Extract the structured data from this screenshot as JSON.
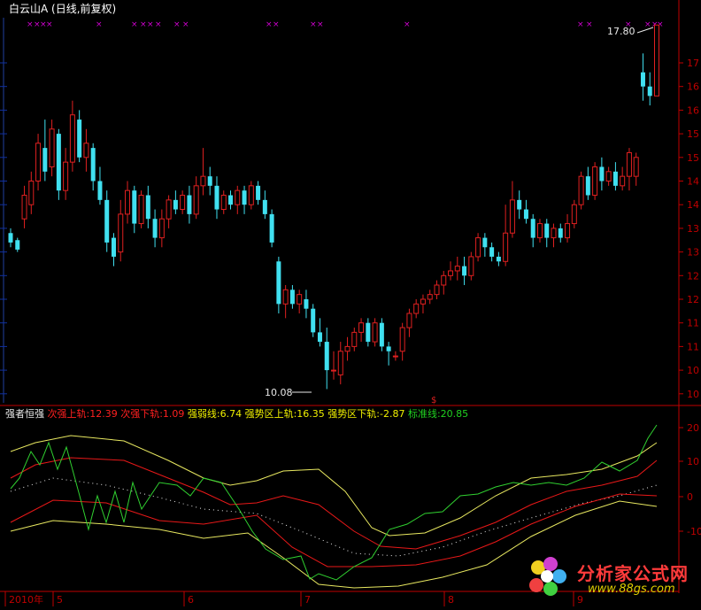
{
  "title": "白云山A (日线,前复权)",
  "price_panel": {
    "y_ticks": [
      "17",
      "16",
      "16",
      "15",
      "15",
      "14",
      "14",
      "13",
      "13",
      "12",
      "12",
      "11",
      "11",
      "10",
      "10"
    ],
    "annotations": {
      "high": "17.80",
      "low": "10.08"
    },
    "marker_top_symbol": "×",
    "marker_bottom_symbol": "$"
  },
  "indicator_panel": {
    "name": "强者恒强",
    "labels": [
      {
        "text": "次强上轨:12.39",
        "color": "#ff2020"
      },
      {
        "text": "次强下轨:1.09",
        "color": "#ff2020"
      },
      {
        "text": "强弱线:6.74",
        "color": "#f0f000"
      },
      {
        "text": "强势区上轨:16.35",
        "color": "#f0f000"
      },
      {
        "text": "强势区下轨:-2.87",
        "color": "#f0f000"
      },
      {
        "text": "标准线:20.85",
        "color": "#20d020"
      }
    ],
    "y_ticks": [
      "20",
      "10",
      "0",
      "-10"
    ]
  },
  "x_axis": {
    "labels": [
      "2010年",
      "5",
      "6",
      "7",
      "8",
      "9"
    ]
  },
  "watermark": {
    "text": "分析家公式网",
    "url": "www.88gs.com"
  },
  "colors": {
    "up": "#e02020",
    "down": "#40e0f0",
    "axis": "#c00000",
    "grid": "#500000",
    "line_red": "#e81818",
    "line_yellow": "#e8e860",
    "line_green": "#30d030",
    "line_dots": "#e8e8e8"
  }
}
